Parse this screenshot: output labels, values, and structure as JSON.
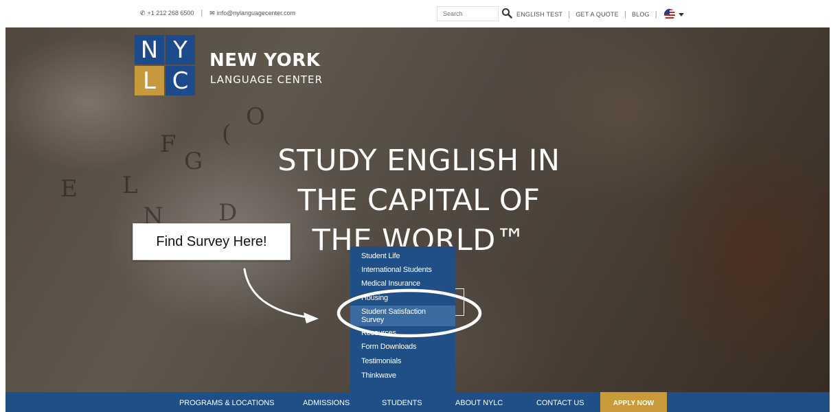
{
  "topbar": {
    "phone": "+1 212 268 6500",
    "email": "info@nylanguagecenter.com",
    "search_placeholder": "Search",
    "links": [
      "ENGLISH TEST",
      "GET A QUOTE",
      "BLOG"
    ],
    "phone_icon": "phone-icon",
    "email_icon": "envelope-icon",
    "search_icon": "magnifier-icon",
    "flag_icon": "us-flag-icon"
  },
  "brand": {
    "letters": [
      "N",
      "Y",
      "L",
      "C"
    ],
    "name_line1": "NEW YORK",
    "name_line2": "LANGUAGE CENTER",
    "blue": "#1c4a8a",
    "gold": "#c69a3c"
  },
  "hero": {
    "headline_lines": [
      "STUDY ENGLISH IN",
      "THE CAPITAL OF",
      "THE WORLD™"
    ]
  },
  "callout": {
    "text": "Find Survey Here!"
  },
  "dropdown": {
    "items": [
      "Student Life",
      "International Students",
      "Medical Insurance",
      "Housing",
      "Student Satisfaction Survey",
      "Resources",
      "Form Downloads",
      "Testimonials",
      "Thinkwave"
    ],
    "active_index": 4,
    "bg_color": "#1f4f86"
  },
  "nav": {
    "items": [
      "PROGRAMS & LOCATIONS",
      "ADMISSIONS",
      "STUDENTS",
      "ABOUT NYLC",
      "CONTACT US"
    ],
    "apply": "APPLY NOW",
    "bg_color": "#1f4f86",
    "apply_color": "#c89a3a"
  }
}
